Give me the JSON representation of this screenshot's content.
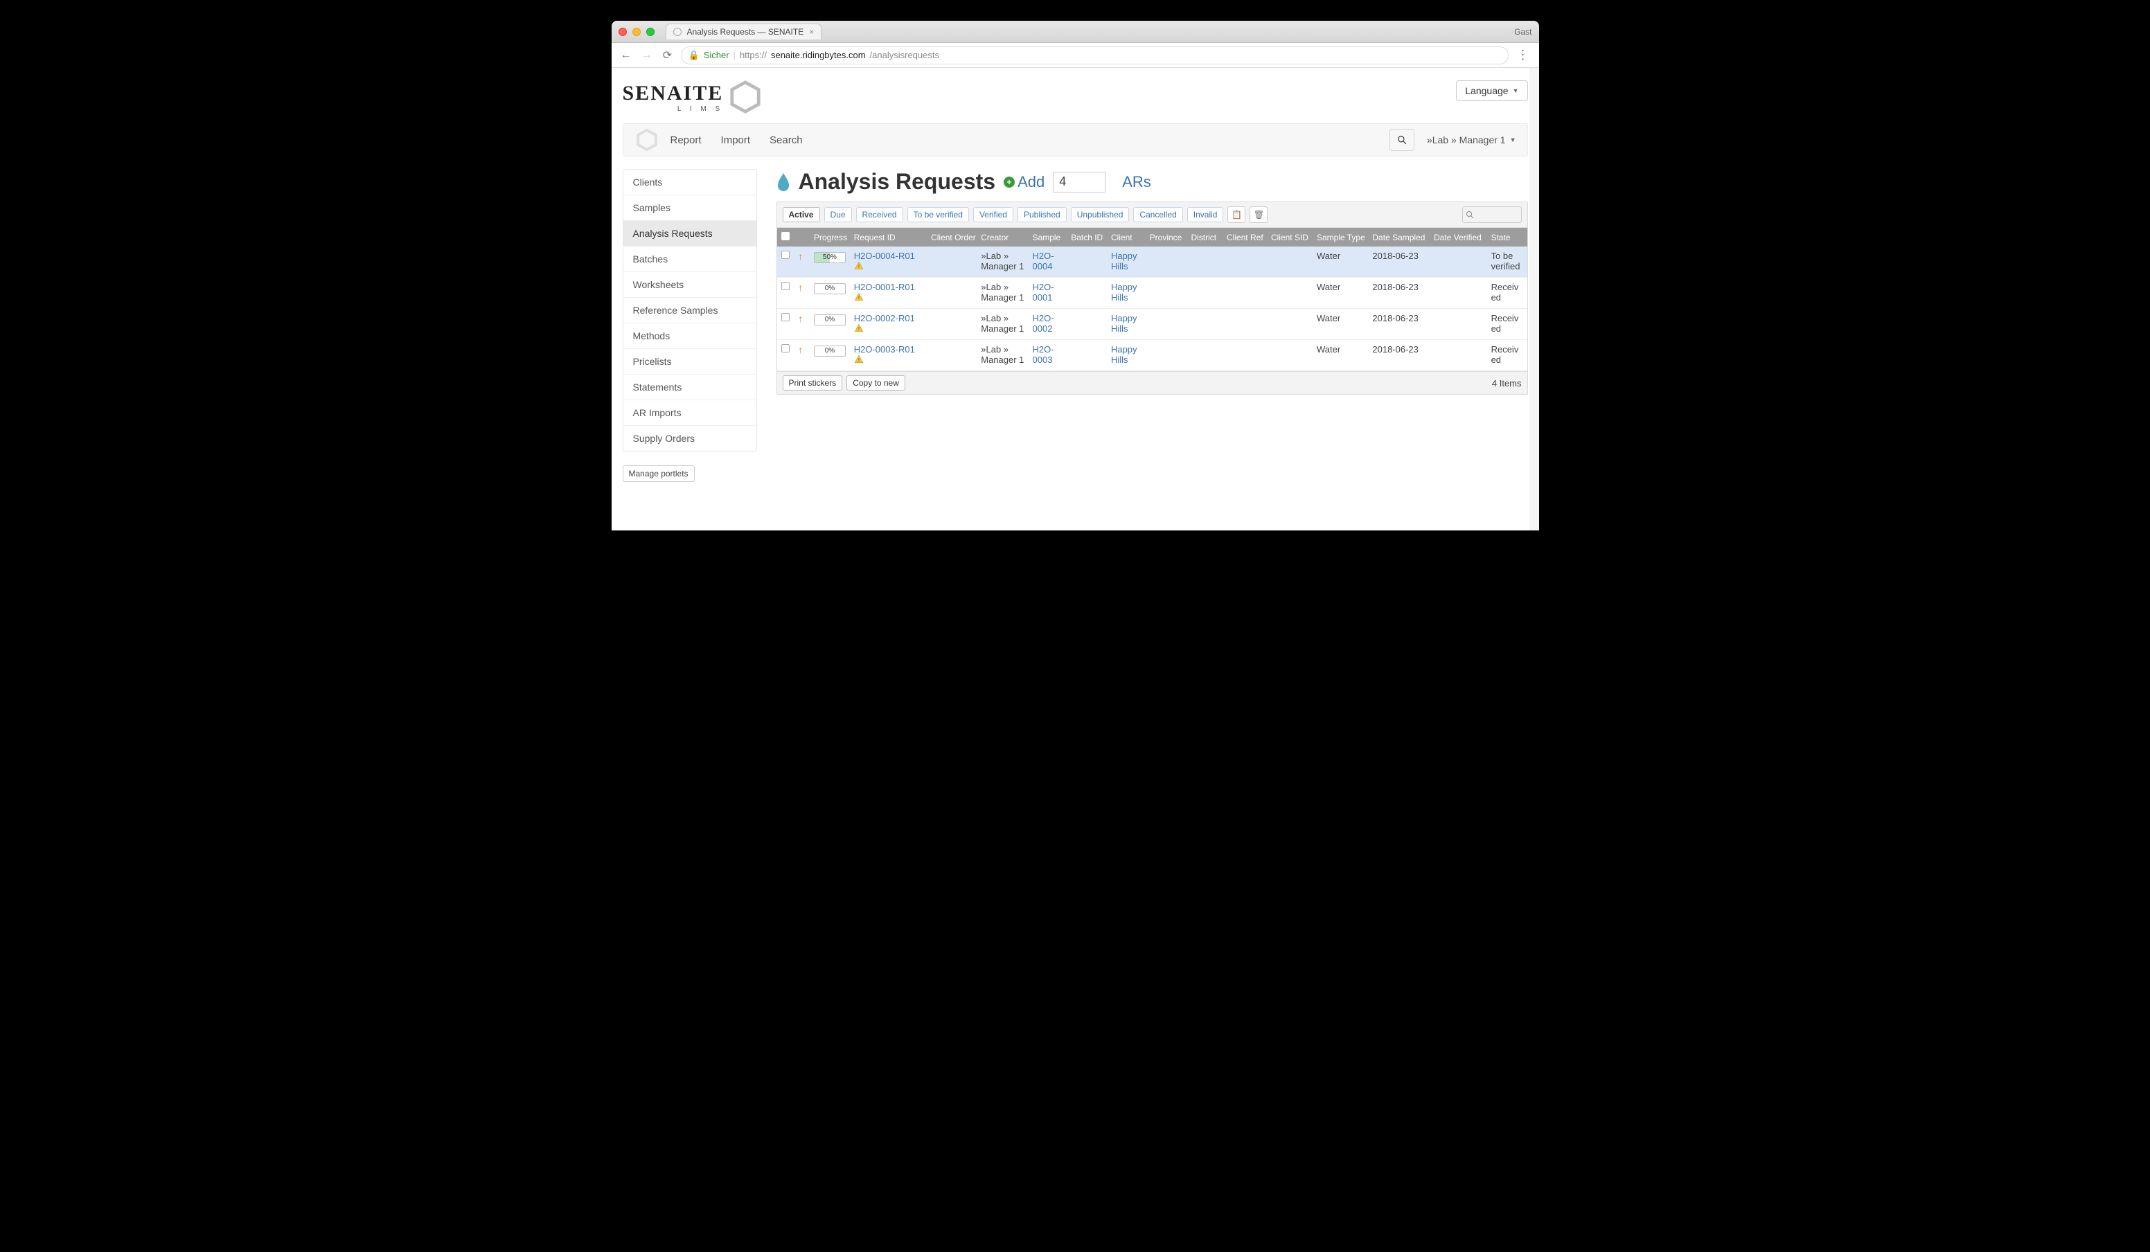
{
  "browser": {
    "tab_title": "Analysis Requests — SENAITE",
    "guest_label": "Gast",
    "secure_label": "Sicher",
    "url_prefix": "https://",
    "url_host": "senaite.ridingbytes.com",
    "url_path": "/analysisrequests"
  },
  "header": {
    "logo_main": "SENAITE",
    "logo_sub": "L I M S",
    "language_label": "Language"
  },
  "topnav": {
    "items": [
      "Report",
      "Import",
      "Search"
    ],
    "user": "»Lab » Manager 1"
  },
  "sidebar": {
    "items": [
      "Clients",
      "Samples",
      "Analysis Requests",
      "Batches",
      "Worksheets",
      "Reference Samples",
      "Methods",
      "Pricelists",
      "Statements",
      "AR Imports",
      "Supply Orders"
    ],
    "active_index": 2,
    "manage_portlets": "Manage portlets"
  },
  "main": {
    "title": "Analysis Requests",
    "add_label": "Add",
    "count_value": "4",
    "ars_label": "ARs"
  },
  "filters": [
    "Active",
    "Due",
    "Received",
    "To be verified",
    "Verified",
    "Published",
    "Unpublished",
    "Cancelled",
    "Invalid"
  ],
  "columns": [
    "",
    "",
    "Progress",
    "Request ID",
    "Client Order",
    "Creator",
    "Sample",
    "Batch ID",
    "Client",
    "Province",
    "District",
    "Client Ref",
    "Client SID",
    "Sample Type",
    "Date Sampled",
    "Date Verified",
    "State"
  ],
  "rows": [
    {
      "progress": "50%",
      "progress_pct": 50,
      "request_id": "H2O-0004-R01",
      "creator": "»Lab » Manager 1",
      "sample": "H2O-0004",
      "client": "Happy Hills",
      "sample_type": "Water",
      "date_sampled": "2018-06-23",
      "state": "To be verified",
      "highlight": true
    },
    {
      "progress": "0%",
      "progress_pct": 0,
      "request_id": "H2O-0001-R01",
      "creator": "»Lab » Manager 1",
      "sample": "H2O-0001",
      "client": "Happy Hills",
      "sample_type": "Water",
      "date_sampled": "2018-06-23",
      "state": "Received",
      "highlight": false
    },
    {
      "progress": "0%",
      "progress_pct": 0,
      "request_id": "H2O-0002-R01",
      "creator": "»Lab » Manager 1",
      "sample": "H2O-0002",
      "client": "Happy Hills",
      "sample_type": "Water",
      "date_sampled": "2018-06-23",
      "state": "Received",
      "highlight": false
    },
    {
      "progress": "0%",
      "progress_pct": 0,
      "request_id": "H2O-0003-R01",
      "creator": "»Lab » Manager 1",
      "sample": "H2O-0003",
      "client": "Happy Hills",
      "sample_type": "Water",
      "date_sampled": "2018-06-23",
      "state": "Received",
      "highlight": false
    }
  ],
  "footer": {
    "print_stickers": "Print stickers",
    "copy_to_new": "Copy to new",
    "items_count": "4 Items"
  }
}
